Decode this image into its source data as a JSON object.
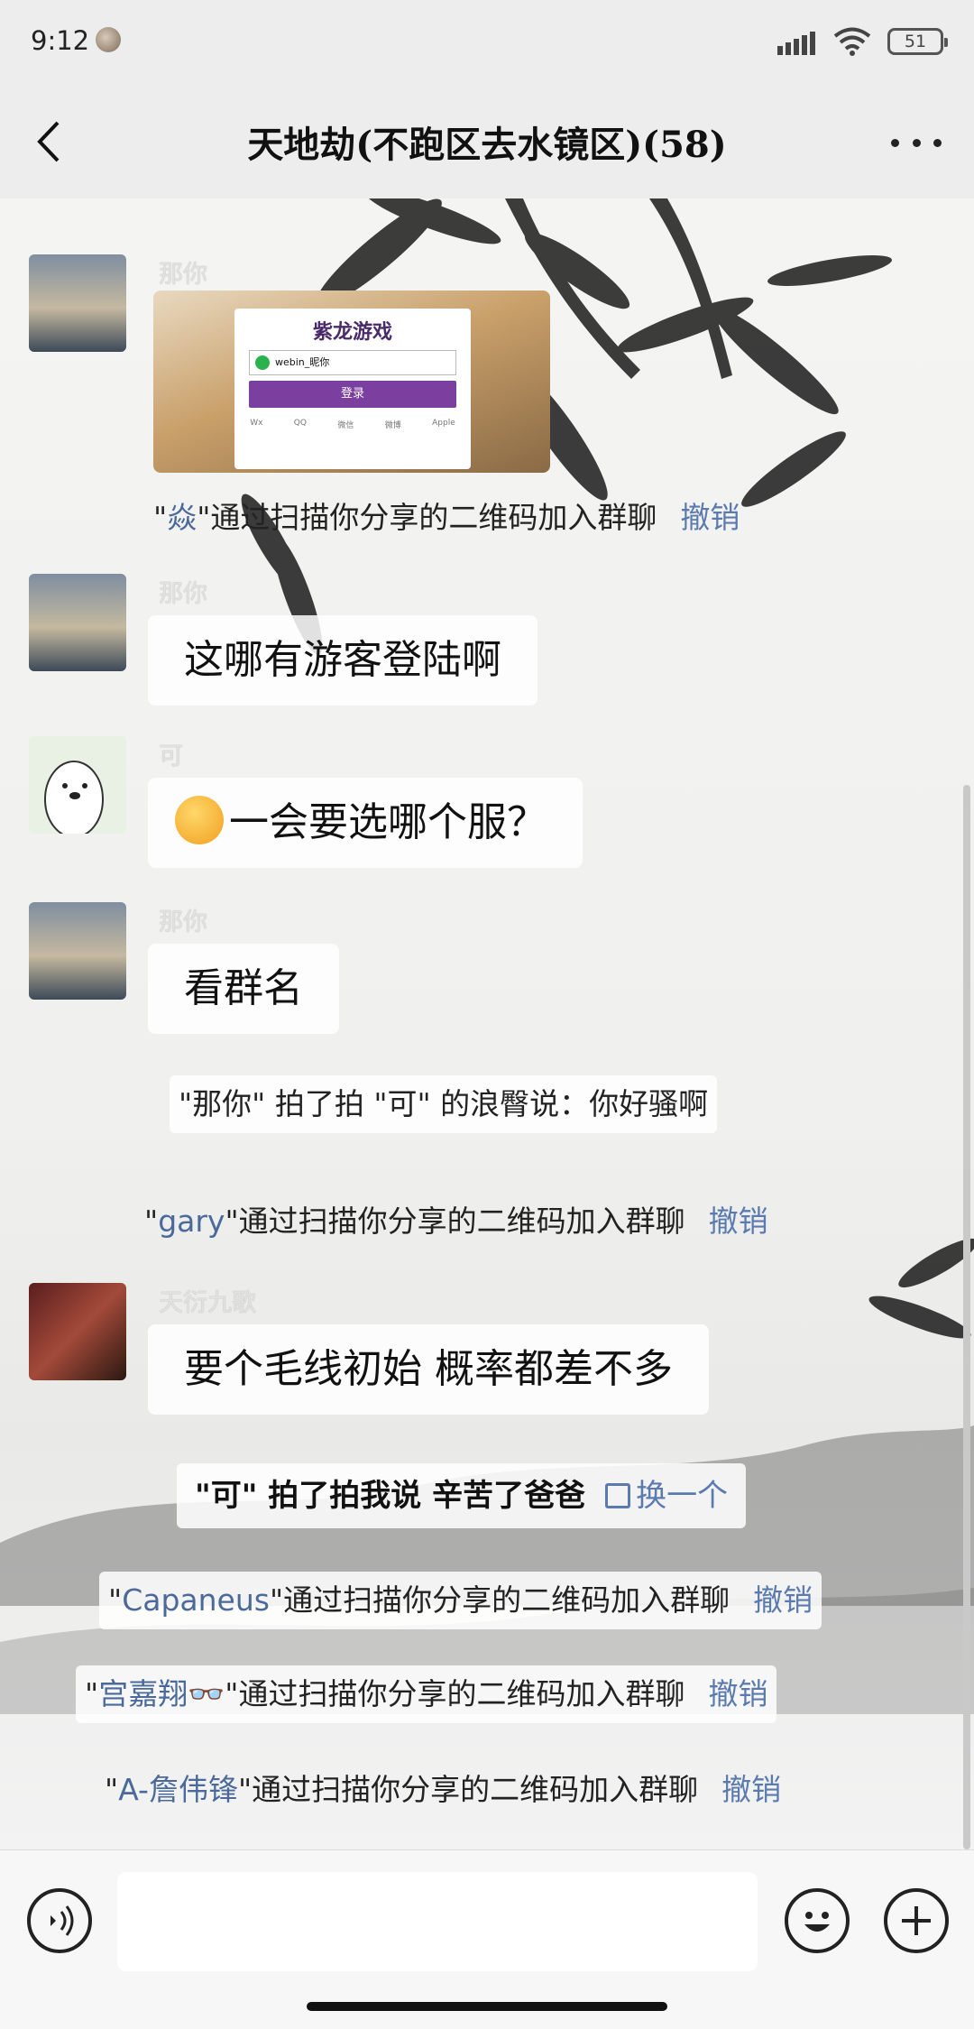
{
  "status_bar": {
    "time": "9:12",
    "battery": "51"
  },
  "header": {
    "title": "天地劫(不跑区去水镜区)(58)"
  },
  "messages": [
    {
      "sender": "那你",
      "image_card": {
        "brand": "紫龙游戏",
        "account": "webin_昵你",
        "login_label": "登录",
        "options": [
          "Wx",
          "QQ",
          "微信",
          "微博",
          "Apple"
        ]
      }
    },
    {
      "system_name": "焱",
      "system_text": "通过扫描你分享的二维码加入群聊",
      "undo": "撤销"
    },
    {
      "sender": "那你",
      "text": "这哪有游客登陆啊"
    },
    {
      "sender": "可",
      "text": "一会要选哪个服？"
    },
    {
      "sender": "那你",
      "text": "看群名"
    },
    {
      "pat_text": "\"那你\" 拍了拍 \"可\" 的浪臀说：你好骚啊"
    },
    {
      "system_name": "gary",
      "system_text": "通过扫描你分享的二维码加入群聊",
      "undo": "撤销"
    },
    {
      "sender": "天衍九歌",
      "text": "要个毛线初始 概率都差不多"
    },
    {
      "pat_text": "\"可\" 拍了拍我说 辛苦了爸爸",
      "swap": "换一个"
    },
    {
      "system_name": "Capaneus",
      "system_text": "通过扫描你分享的二维码加入群聊",
      "undo": "撤销"
    },
    {
      "system_name": "宫嘉翔👓",
      "system_text": "通过扫描你分享的二维码加入群聊",
      "undo": "撤销"
    },
    {
      "system_name": "A-詹伟锋",
      "system_text": "通过扫描你分享的二维码加入群聊",
      "undo": "撤销"
    }
  ],
  "colors": {
    "link": "#4b6a9b",
    "undo": "#5b7bb0",
    "login_button": "#7b3fa0"
  }
}
